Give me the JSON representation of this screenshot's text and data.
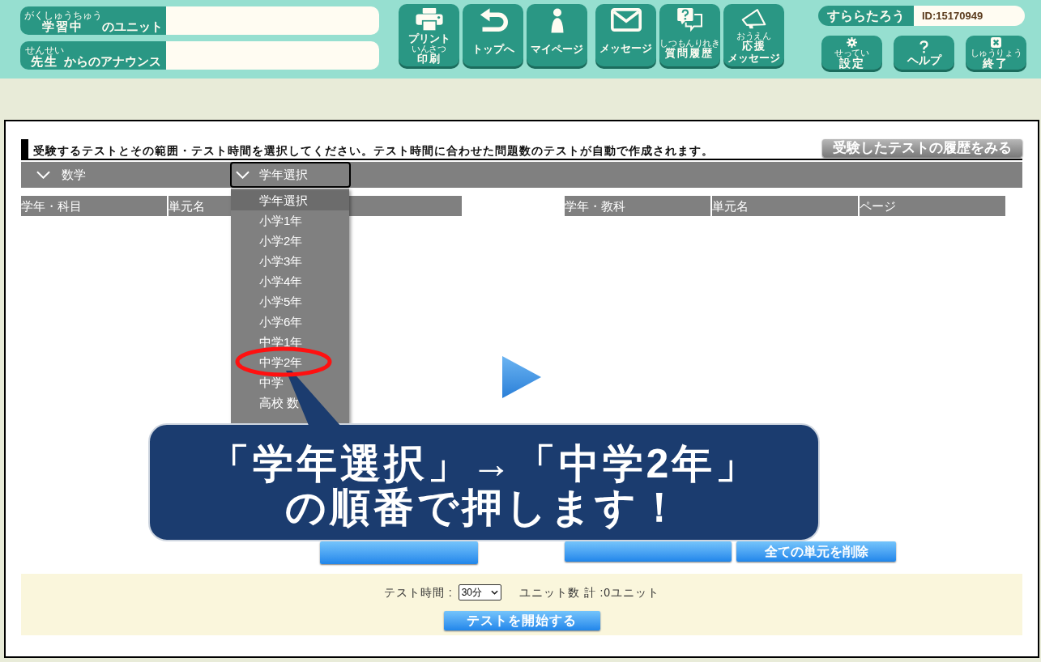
{
  "header": {
    "info_bars": [
      {
        "label": [
          {
            "text": "学習中",
            "ruby": "がくしゅうちゅう"
          },
          {
            "text": "のユニット"
          }
        ]
      },
      {
        "label": [
          {
            "text": "先生",
            "ruby": "せんせい"
          },
          {
            "text": "からのアナウンス"
          }
        ]
      }
    ],
    "nav_groups": [
      [
        {
          "kind": "print",
          "lines": [
            [
              {
                "text": "プリント"
              }
            ],
            [
              {
                "text": "印刷",
                "ruby": "いんさつ"
              }
            ]
          ]
        },
        {
          "kind": "top",
          "lines": [
            [
              {
                "text": "トップへ"
              }
            ]
          ]
        },
        {
          "kind": "mypage",
          "lines": [
            [
              {
                "text": "マイページ"
              }
            ]
          ]
        }
      ],
      [
        {
          "kind": "message",
          "lines": [
            [
              {
                "text": "メッセージ"
              }
            ]
          ]
        },
        {
          "kind": "question",
          "lines": [
            [
              {
                "text": "質問履歴",
                "ruby": "しつもんりれき"
              }
            ]
          ]
        },
        {
          "kind": "cheer",
          "lines": [
            [
              {
                "text": "応援",
                "ruby": "おうえん"
              }
            ],
            [
              {
                "text": "メッセージ"
              }
            ]
          ]
        }
      ]
    ],
    "user": {
      "name": "すららたろう",
      "id": "ID:15170949"
    },
    "tool_buttons": [
      {
        "kind": "settings",
        "lines": [
          [
            {
              "text": "設定",
              "ruby": "せってい"
            }
          ]
        ]
      },
      {
        "kind": "help",
        "lines": [
          [
            {
              "text": "ヘルプ"
            }
          ]
        ]
      },
      {
        "kind": "exit",
        "lines": [
          [
            {
              "text": "終了",
              "ruby": "しゅうりょう"
            }
          ]
        ]
      }
    ]
  },
  "instruction": "受験するテストとその範囲・テスト時間を選択してください。テスト時間に合わせた問題数のテストが自動で作成されます。",
  "history_button": "受験したテストの履歴をみる",
  "filters": {
    "subject": {
      "value": "数学"
    },
    "grade": {
      "value": "学年選択",
      "expanded": true,
      "options": [
        {
          "label": "学年選択",
          "selected": true
        },
        {
          "label": "小学1年",
          "selected": false
        },
        {
          "label": "小学2年",
          "selected": false
        },
        {
          "label": "小学3年",
          "selected": false
        },
        {
          "label": "小学4年",
          "selected": false
        },
        {
          "label": "小学5年",
          "selected": false
        },
        {
          "label": "小学6年",
          "selected": false
        },
        {
          "label": "中学1年",
          "selected": false
        },
        {
          "label": "中学2年",
          "selected": false
        },
        {
          "label": "中学",
          "selected": false
        },
        {
          "label": "高校 数",
          "selected": false
        }
      ]
    }
  },
  "left_table": {
    "columns": [
      {
        "kind": "text",
        "label": "学年・科目"
      },
      {
        "kind": "text",
        "label": "単元名"
      },
      {
        "kind": "covered"
      }
    ]
  },
  "right_table": {
    "columns": [
      {
        "kind": "text",
        "label": "学年・教科"
      },
      {
        "kind": "text",
        "label": "単元名"
      },
      {
        "kind": "text",
        "label": "ページ"
      }
    ]
  },
  "action_buttons": [
    {
      "kind": "covered"
    },
    {
      "kind": "covered"
    },
    {
      "kind": "labeled",
      "label": "全ての単元を削除"
    }
  ],
  "footer": {
    "duration_label": "テスト時間 :",
    "duration": "30分",
    "unit_total": "ユニット数 計 :0ユニット",
    "start_button": "テストを開始する"
  },
  "callout": {
    "lines": [
      "「学年選択」→「中学2年」",
      "の順番で押します！"
    ]
  }
}
